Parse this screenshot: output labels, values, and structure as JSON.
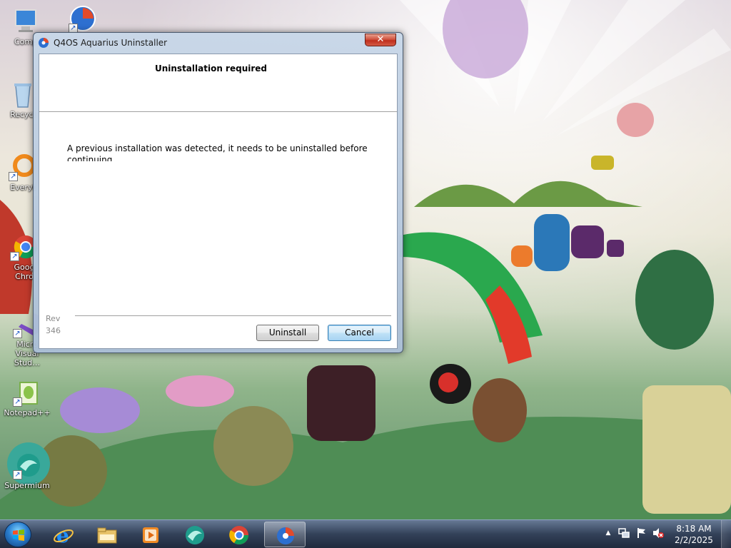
{
  "desktop": {
    "icons": [
      {
        "label": "Comp",
        "icon": "computer-icon"
      },
      {
        "label": "",
        "icon": "q4os-icon"
      },
      {
        "label": "Recycl",
        "icon": "recycle-bin-icon"
      },
      {
        "label": "Everyt",
        "icon": "everything-search-icon"
      },
      {
        "label": "Goog\nChro",
        "icon": "google-chrome-icon"
      },
      {
        "label": "Micro\nVisual Stud…",
        "icon": "visual-studio-icon"
      },
      {
        "label": "Notepad++",
        "icon": "notepad-plus-plus-icon"
      },
      {
        "label": "Supermium",
        "icon": "supermium-icon"
      }
    ]
  },
  "dialog": {
    "title": "Q4OS Aquarius Uninstaller",
    "close_label": "✕",
    "header": "Uninstallation required",
    "message": "A previous installation was detected, it needs to be uninstalled before continuing",
    "revision": "Rev\n346",
    "buttons": {
      "uninstall": "Uninstall",
      "cancel": "Cancel"
    }
  },
  "taskbar": {
    "pinned": [
      {
        "name": "internet-explorer-icon"
      },
      {
        "name": "file-explorer-icon"
      },
      {
        "name": "media-player-icon"
      },
      {
        "name": "supermium-icon"
      },
      {
        "name": "google-chrome-icon"
      },
      {
        "name": "q4os-uninstaller-icon",
        "active": true
      }
    ],
    "tray": {
      "icons": [
        "show-hidden-icons-icon",
        "network-icon",
        "action-center-flag-icon",
        "volume-muted-icon"
      ],
      "time": "8:18 AM",
      "date": "2/2/2025"
    }
  },
  "colors": {
    "accent": "#3c7fb1",
    "close_button": "#c7402b"
  }
}
